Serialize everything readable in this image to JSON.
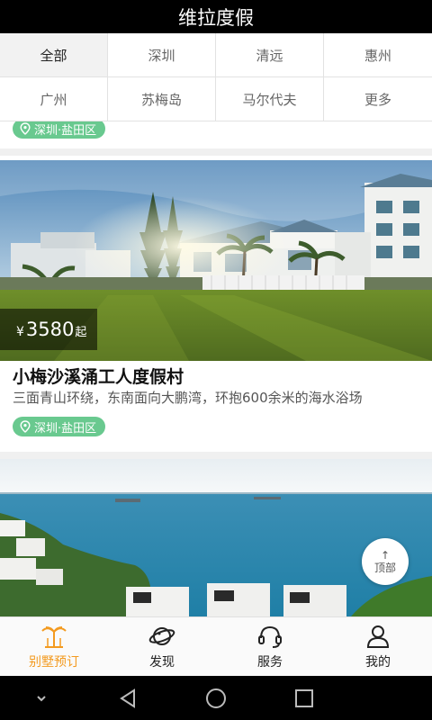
{
  "header": {
    "title": "维拉度假"
  },
  "filters": [
    "全部",
    "深圳",
    "清远",
    "惠州",
    "广州",
    "苏梅岛",
    "马尔代夫",
    "更多"
  ],
  "previous_card": {
    "location": "深圳·盐田区"
  },
  "card": {
    "price_symbol": "¥",
    "price": "3580",
    "price_suffix": "起",
    "title": "小梅沙溪涌工人度假村",
    "description": "三面青山环绕，东南面向大鹏湾，环抱600余米的海水浴场",
    "location": "深圳·盐田区"
  },
  "back_to_top": {
    "arrow": "↑",
    "label": "顶部"
  },
  "tabbar": [
    {
      "label": "别墅预订",
      "icon": "palm-icon"
    },
    {
      "label": "发现",
      "icon": "planet-icon"
    },
    {
      "label": "服务",
      "icon": "headset-icon"
    },
    {
      "label": "我的",
      "icon": "user-icon"
    }
  ],
  "colors": {
    "accent": "#f39a1f",
    "tag": "#69c98f",
    "header": "#000000"
  }
}
